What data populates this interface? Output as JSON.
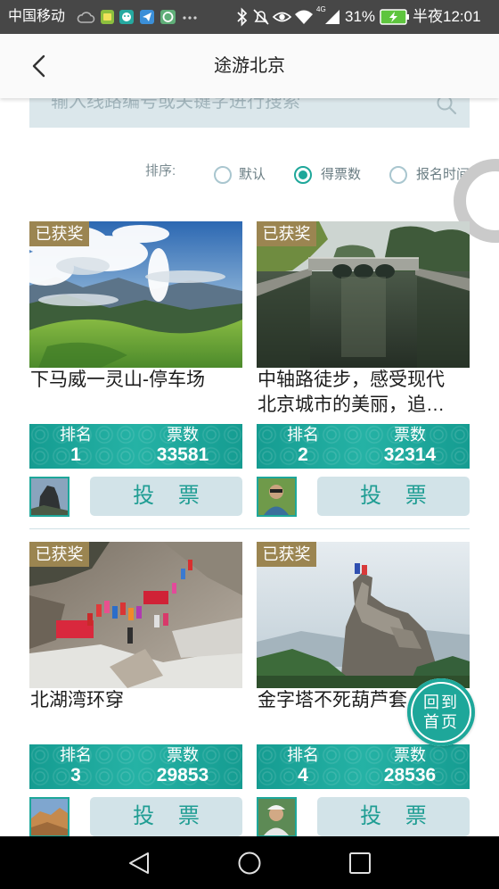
{
  "colors": {
    "accent": "#1ea79a",
    "badge": "#9b8551",
    "button_bg": "#d2e3e8",
    "status_bar": "#474747"
  },
  "status_bar": {
    "carrier": "中国移动",
    "network": "4G",
    "battery": "31%",
    "time": "半夜12:01",
    "icons": [
      "weather-icon",
      "app-notification-icons",
      "more-icon",
      "bluetooth-icon",
      "mute-icon",
      "eye-icon",
      "wifi-icon",
      "signal-icon",
      "battery-icon"
    ]
  },
  "header": {
    "title": "途游北京",
    "back_icon": "chevron-left-icon"
  },
  "search": {
    "placeholder": "输入线路编号或关键字进行搜索",
    "value": "",
    "icon": "search-icon"
  },
  "sort": {
    "label": "排序:",
    "options": [
      {
        "label": "默认",
        "selected": false
      },
      {
        "label": "得票数",
        "selected": true
      },
      {
        "label": "报名时间",
        "selected": false
      }
    ]
  },
  "routes": [
    {
      "badge": "已获奖",
      "title": "下马威一灵山-停车场",
      "rank_label": "排名",
      "rank": 1,
      "votes_label": "票数",
      "votes": 33581,
      "vote_label": "投 票"
    },
    {
      "badge": "已获奖",
      "title": "中轴路徒步，感受现代北京城市的美丽，追…",
      "rank_label": "排名",
      "rank": 2,
      "votes_label": "票数",
      "votes": 32314,
      "vote_label": "投 票"
    },
    {
      "badge": "已获奖",
      "title": "北湖湾环穿",
      "rank_label": "排名",
      "rank": 3,
      "votes_label": "票数",
      "votes": 29853,
      "vote_label": "投 票"
    },
    {
      "badge": "已获奖",
      "title": "金字塔不死葫芦套",
      "rank_label": "排名",
      "rank": 4,
      "votes_label": "票数",
      "votes": 28536,
      "vote_label": "投 票"
    }
  ],
  "back_to_home": {
    "line1": "回到",
    "line2": "首页"
  },
  "nav_bar": {
    "icons": [
      "back-icon",
      "home-icon",
      "recent-apps-icon"
    ]
  }
}
